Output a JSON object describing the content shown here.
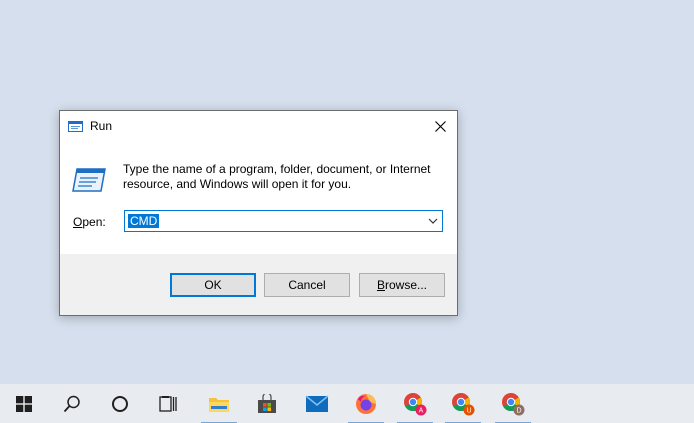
{
  "dialog": {
    "title": "Run",
    "description": "Type the name of a program, folder, document, or Internet resource, and Windows will open it for you.",
    "open_label_accel": "O",
    "open_label_rest": "pen:",
    "input_value": "CMD",
    "ok_label": "OK",
    "cancel_label": "Cancel",
    "browse_label_accel": "B",
    "browse_label_rest": "rowse...",
    "icons": {
      "title": "run-icon",
      "close": "close-icon",
      "dropdown": "chevron-down-icon"
    }
  },
  "taskbar": {
    "items": [
      {
        "name": "start-button",
        "icon": "windows-logo-icon"
      },
      {
        "name": "search-button",
        "icon": "search-icon"
      },
      {
        "name": "cortana-button",
        "icon": "circle-icon"
      },
      {
        "name": "task-view-button",
        "icon": "task-view-icon"
      },
      {
        "name": "file-explorer-button",
        "icon": "folder-icon"
      },
      {
        "name": "microsoft-store-button",
        "icon": "store-icon"
      },
      {
        "name": "mail-button",
        "icon": "mail-icon"
      },
      {
        "name": "firefox-button",
        "icon": "firefox-icon"
      },
      {
        "name": "chrome-profile-a-button",
        "icon": "chrome-icon",
        "badge": "A"
      },
      {
        "name": "chrome-profile-u-button",
        "icon": "chrome-icon",
        "badge": "U"
      },
      {
        "name": "chrome-profile-d-button",
        "icon": "chrome-icon",
        "badge": "D"
      }
    ]
  },
  "colors": {
    "desktop": "#d5dfed",
    "accent": "#0078d7",
    "taskbar": "#e8ebef"
  }
}
